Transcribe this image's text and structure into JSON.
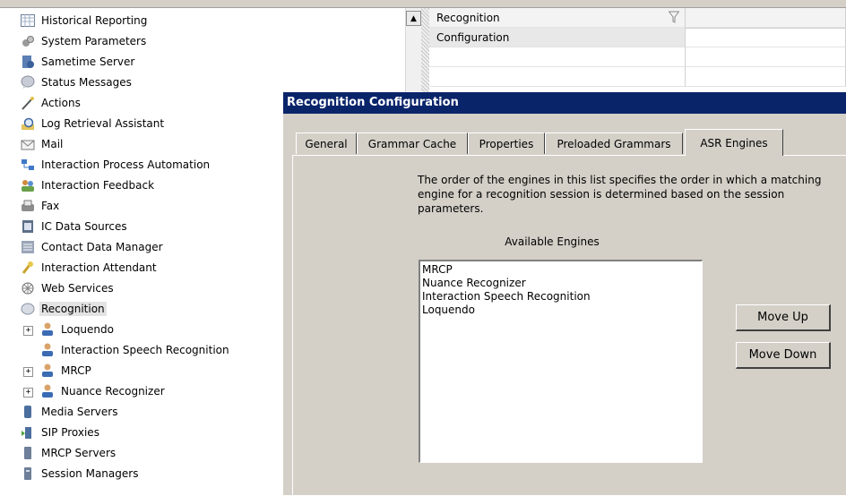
{
  "tree": {
    "items": [
      {
        "label": "Historical Reporting",
        "icon": "grid-report-icon"
      },
      {
        "label": "System Parameters",
        "icon": "gears-icon"
      },
      {
        "label": "Sametime Server",
        "icon": "server-icon"
      },
      {
        "label": "Status Messages",
        "icon": "speech-bubble-icon"
      },
      {
        "label": "Actions",
        "icon": "wand-icon"
      },
      {
        "label": "Log Retrieval Assistant",
        "icon": "magnifier-log-icon"
      },
      {
        "label": "Mail",
        "icon": "mail-icon"
      },
      {
        "label": "Interaction Process Automation",
        "icon": "process-icon"
      },
      {
        "label": "Interaction Feedback",
        "icon": "people-icon"
      },
      {
        "label": "Fax",
        "icon": "fax-icon"
      },
      {
        "label": "IC Data Sources",
        "icon": "data-source-icon"
      },
      {
        "label": "Contact Data Manager",
        "icon": "contact-data-icon"
      },
      {
        "label": "Interaction Attendant",
        "icon": "attendant-icon"
      },
      {
        "label": "Web Services",
        "icon": "web-services-icon"
      },
      {
        "label": "Recognition",
        "icon": "recognition-icon"
      },
      {
        "label": "Loquendo",
        "icon": "user-icon"
      },
      {
        "label": "Interaction Speech Recognition",
        "icon": "user-icon"
      },
      {
        "label": "MRCP",
        "icon": "user-icon"
      },
      {
        "label": "Nuance Recognizer",
        "icon": "user-icon"
      },
      {
        "label": "Media Servers",
        "icon": "media-server-icon"
      },
      {
        "label": "SIP Proxies",
        "icon": "sip-proxy-icon"
      },
      {
        "label": "MRCP Servers",
        "icon": "mrcp-server-icon"
      },
      {
        "label": "Session Managers",
        "icon": "session-manager-icon"
      }
    ],
    "expander_symbol": "+"
  },
  "scrollbar": {
    "up_arrow": "▲"
  },
  "grid": {
    "header": "Recognition",
    "rows": [
      "Configuration"
    ]
  },
  "dialog": {
    "title": "Recognition Configuration",
    "tabs": [
      "General",
      "Grammar Cache",
      "Properties",
      "Preloaded Grammars",
      "ASR Engines"
    ],
    "active_tab": "ASR Engines",
    "description": "The order of the engines in this list specifies the order in which a matching engine for a recognition session is determined based on the session parameters.",
    "available_label": "Available Engines",
    "engines": [
      "MRCP",
      "Nuance Recognizer",
      "Interaction Speech Recognition",
      "Loquendo"
    ],
    "move_up": "Move Up",
    "move_down": "Move Down"
  },
  "colors": {
    "title_bar": "#0a246a",
    "dialog_bg": "#d4d0c8",
    "selection": "#e3e3e3"
  }
}
